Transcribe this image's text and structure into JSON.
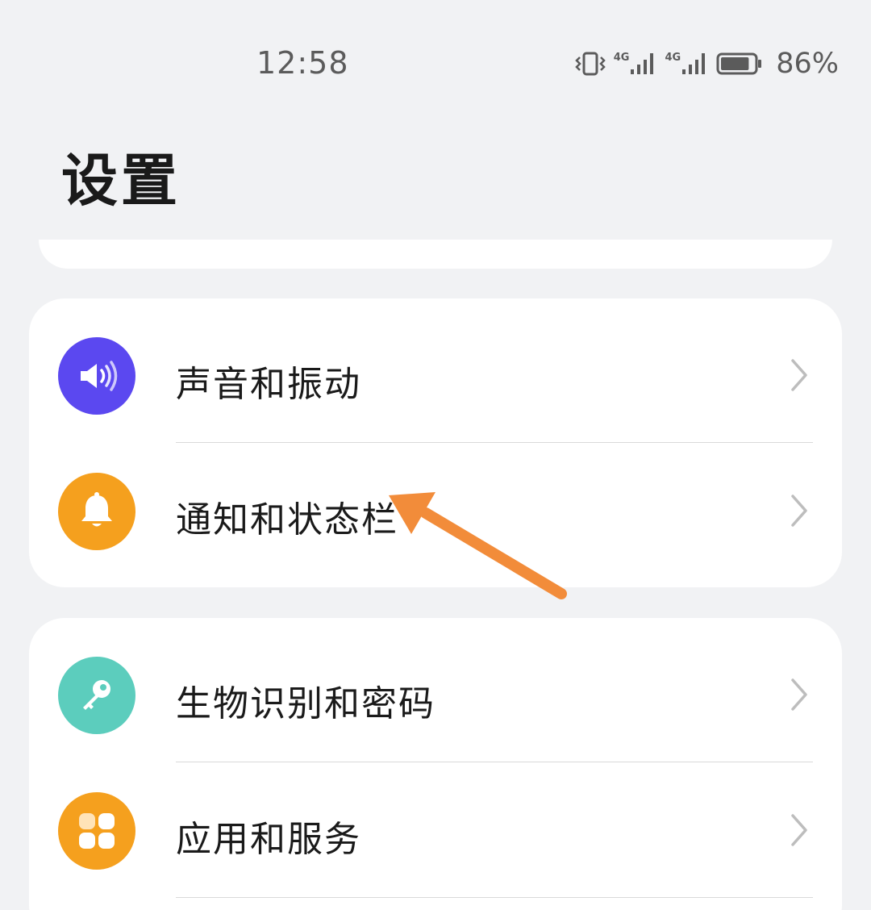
{
  "status_bar": {
    "time": "12:58",
    "network_1": "4G",
    "network_2": "4G",
    "battery_percent": "86%",
    "battery_level": 0.86
  },
  "header": {
    "title": "设置"
  },
  "search": {},
  "groups": [
    {
      "items": [
        {
          "label": "声音和振动",
          "icon": "speaker-icon",
          "icon_color": "#5b48f0"
        },
        {
          "label": "通知和状态栏",
          "icon": "bell-icon",
          "icon_color": "#f5a01e"
        }
      ]
    },
    {
      "items": [
        {
          "label": "生物识别和密码",
          "icon": "key-icon",
          "icon_color": "#5ccdbd"
        },
        {
          "label": "应用和服务",
          "icon": "apps-grid-icon",
          "icon_color": "#f5a01e"
        }
      ]
    }
  ],
  "annotation": {
    "arrow_color": "#f28c3a"
  },
  "colors": {
    "background": "#f1f2f4",
    "card": "#ffffff",
    "chevron": "#bdbdbd"
  }
}
